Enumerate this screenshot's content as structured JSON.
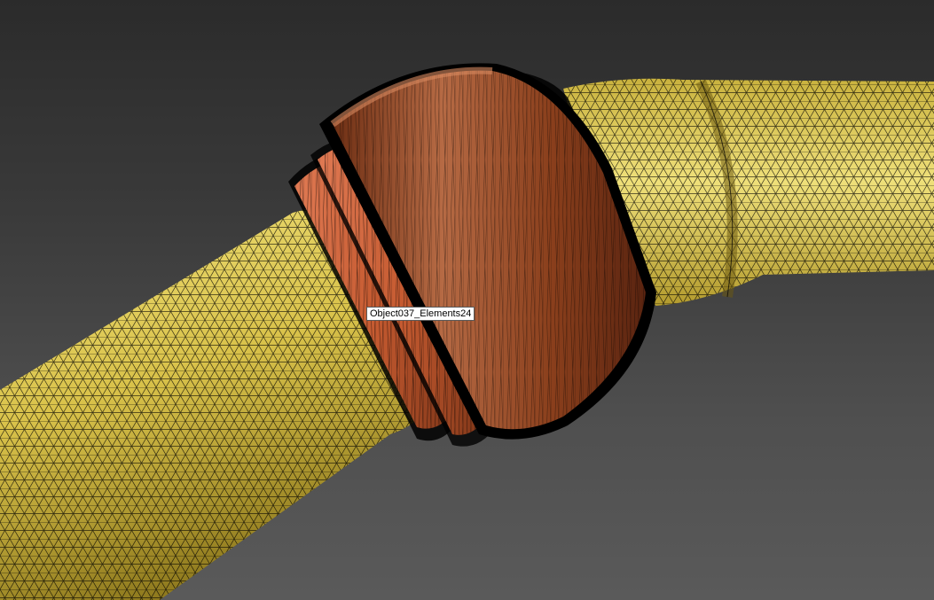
{
  "viewport": {
    "label": "3D perspective viewport",
    "shading": "wireframe-over-shaded",
    "colors": {
      "background_top": "#2b2b2b",
      "background_bottom": "#5a5a5a",
      "pipe": "#d9c24a",
      "coupling": "#9a4a24",
      "coupling_highlight": "#e07a54",
      "wire": "#000000"
    }
  },
  "tooltip": {
    "text": "Object037_Elements24"
  }
}
